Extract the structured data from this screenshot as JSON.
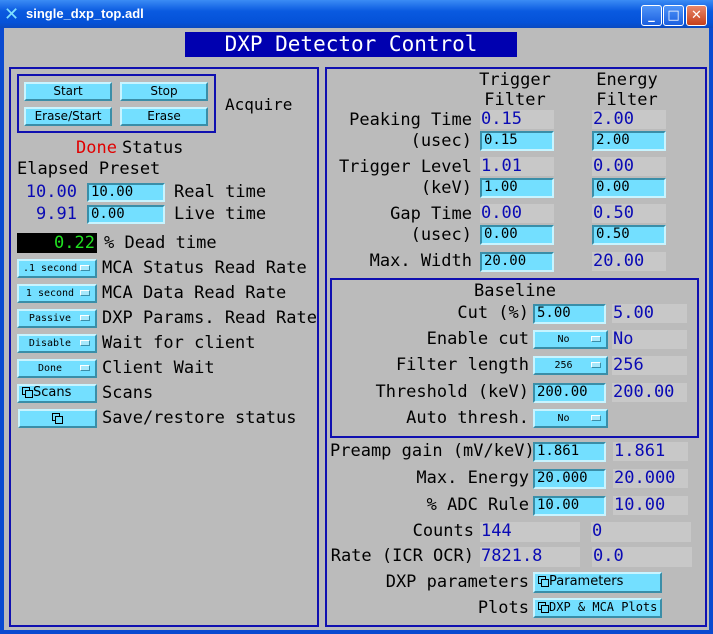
{
  "window": {
    "title": "single_dxp_top.adl",
    "banner": "DXP Detector Control"
  },
  "acquire": {
    "start": "Start",
    "stop": "Stop",
    "erase_start": "Erase/Start",
    "erase": "Erase",
    "label": "Acquire"
  },
  "status": {
    "value": "Done",
    "label": "Status"
  },
  "times": {
    "header": "Elapsed Preset",
    "real_elapsed": "10.00",
    "real_preset": "10.00",
    "real_label": "Real time",
    "live_elapsed": "9.91",
    "live_preset": "0.00",
    "live_label": "Live time"
  },
  "dead": {
    "value": "0.22",
    "label": "% Dead time"
  },
  "settings": [
    {
      "value": ".1 second",
      "label": "MCA Status Read Rate"
    },
    {
      "value": "1 second",
      "label": "MCA Data Read Rate"
    },
    {
      "value": "Passive",
      "label": "DXP Params. Read Rate"
    },
    {
      "value": "Disable",
      "label": "Wait for client"
    },
    {
      "value": "Done",
      "label": "Client Wait"
    }
  ],
  "scans": {
    "button": "Scans",
    "label": "Scans"
  },
  "saverestore": {
    "label": "Save/restore status"
  },
  "filters": {
    "trigger_header": [
      "Trigger",
      "Filter"
    ],
    "energy_header": [
      "Energy",
      "Filter"
    ],
    "peaking": {
      "label": "Peaking Time",
      "unit": "(usec)",
      "trig_rbv": "0.15",
      "trig_set": "0.15",
      "en_rbv": "2.00",
      "en_set": "2.00"
    },
    "trigger_level": {
      "label": "Trigger Level",
      "unit": "(keV)",
      "trig_rbv": "1.01",
      "trig_set": "1.00",
      "en_rbv": "0.00",
      "en_set": "0.00"
    },
    "gap": {
      "label": "Gap Time",
      "unit": "(usec)",
      "trig_rbv": "0.00",
      "trig_set": "0.00",
      "en_rbv": "0.50",
      "en_set": "0.50"
    },
    "max_width": {
      "label": "Max. Width",
      "trig_set": "20.00",
      "en_rbv": "20.00"
    }
  },
  "baseline": {
    "title": "Baseline",
    "cut": {
      "label": "Cut (%)",
      "set": "5.00",
      "rbv": "5.00"
    },
    "enable_cut": {
      "label": "Enable cut",
      "set": "No",
      "rbv": "No"
    },
    "filter_length": {
      "label": "Filter length",
      "set": "256",
      "rbv": "256"
    },
    "threshold": {
      "label": "Threshold (keV)",
      "set": "200.00",
      "rbv": "200.00"
    },
    "auto_thresh": {
      "label": "Auto thresh.",
      "set": "No"
    }
  },
  "preamp": {
    "label": "Preamp gain (mV/keV)",
    "set": "1.861",
    "rbv": "1.861"
  },
  "max_energy": {
    "label": "Max. Energy",
    "set": "20.000",
    "rbv": "20.000"
  },
  "adc_rule": {
    "label": "% ADC Rule",
    "set": "10.00",
    "rbv": "10.00"
  },
  "counts": {
    "label": "Counts",
    "a": "144",
    "b": "0"
  },
  "rate": {
    "label": "Rate (ICR OCR)",
    "icr": "7821.8",
    "ocr": "0.0"
  },
  "dxp_params": {
    "label": "DXP parameters",
    "button": "Parameters"
  },
  "plots": {
    "label": "Plots",
    "button": "DXP & MCA Plots"
  }
}
